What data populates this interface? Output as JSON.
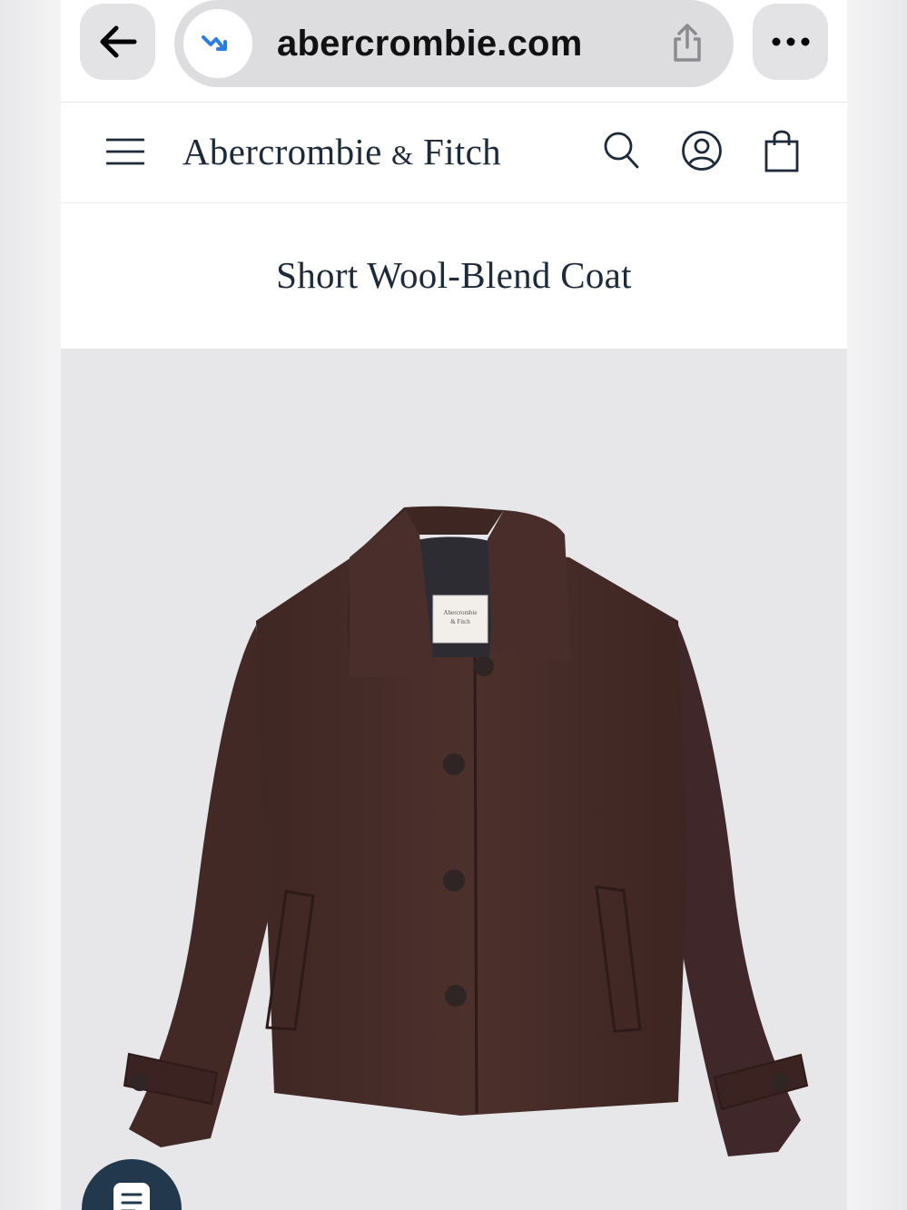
{
  "browser": {
    "url": "abercrombie.com"
  },
  "header": {
    "brand_main": "Abercrombie",
    "brand_amp": "&",
    "brand_end": "Fitch"
  },
  "product": {
    "title": "Short Wool-Blend Coat",
    "image_alt": "brown short wool-blend coat",
    "label_brand": "Abercrombie & Fitch"
  },
  "colors": {
    "coat": "#4a2f2b",
    "background_image": "#e7e6e8",
    "brand_navy": "#1d2a3a",
    "chat_button": "#22384c"
  },
  "icons": [
    "back-arrow-icon",
    "site-badge-icon",
    "share-icon",
    "more-icon",
    "menu-icon",
    "search-icon",
    "account-icon",
    "bag-icon",
    "chat-icon"
  ]
}
